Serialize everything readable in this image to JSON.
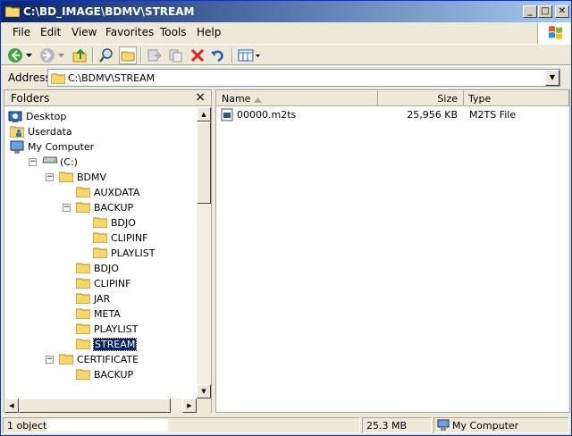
{
  "window": {
    "title": "C:\\BD_IMAGE\\BDMV\\STREAM",
    "minimize": "_",
    "maximize": "□",
    "close": "✕"
  },
  "menu": [
    "File",
    "Edit",
    "View",
    "Favorites",
    "Tools",
    "Help"
  ],
  "toolbar": {
    "icons": [
      "back-icon",
      "forward-icon",
      "up-icon",
      "search-icon",
      "folders-icon",
      "move-to-icon",
      "copy-to-icon",
      "delete-icon",
      "undo-icon",
      "views-icon"
    ]
  },
  "address": {
    "label": "Address",
    "value": "C:\\BDMV\\STREAM"
  },
  "folders_pane": {
    "title": "Folders",
    "close": "×",
    "tree": [
      {
        "label": "Desktop",
        "icon": "desktop-icon",
        "expander": ""
      },
      {
        "label": "Userdata",
        "icon": "user-folder-icon",
        "expander": "+"
      },
      {
        "label": "My Computer",
        "icon": "computer-icon",
        "expander": "−"
      },
      {
        "label": "(C:)",
        "icon": "drive-icon",
        "expander": "−"
      },
      {
        "label": "BDMV",
        "icon": "folder-icon",
        "expander": "−"
      },
      {
        "label": "AUXDATA",
        "icon": "folder-icon",
        "expander": ""
      },
      {
        "label": "BACKUP",
        "icon": "folder-icon",
        "expander": "−"
      },
      {
        "label": "BDJO",
        "icon": "folder-icon",
        "expander": ""
      },
      {
        "label": "CLIPINF",
        "icon": "folder-icon",
        "expander": ""
      },
      {
        "label": "PLAYLIST",
        "icon": "folder-icon",
        "expander": ""
      },
      {
        "label": "BDJO",
        "icon": "folder-icon",
        "expander": ""
      },
      {
        "label": "CLIPINF",
        "icon": "folder-icon",
        "expander": ""
      },
      {
        "label": "JAR",
        "icon": "folder-icon",
        "expander": ""
      },
      {
        "label": "META",
        "icon": "folder-icon",
        "expander": ""
      },
      {
        "label": "PLAYLIST",
        "icon": "folder-icon",
        "expander": ""
      },
      {
        "label": "STREAM",
        "icon": "folder-icon",
        "expander": "",
        "selected": true
      },
      {
        "label": "CERTIFICATE",
        "icon": "folder-icon",
        "expander": "−"
      },
      {
        "label": "BACKUP",
        "icon": "folder-icon",
        "expander": ""
      }
    ]
  },
  "list": {
    "columns": [
      "Name",
      "Size",
      "Type"
    ],
    "rows": [
      {
        "name": "00000.m2ts",
        "size": "25,956 KB",
        "type": "M2TS File"
      }
    ]
  },
  "status": {
    "objects": "1 objects",
    "size": "25.3 MB",
    "location": "My Computer"
  }
}
